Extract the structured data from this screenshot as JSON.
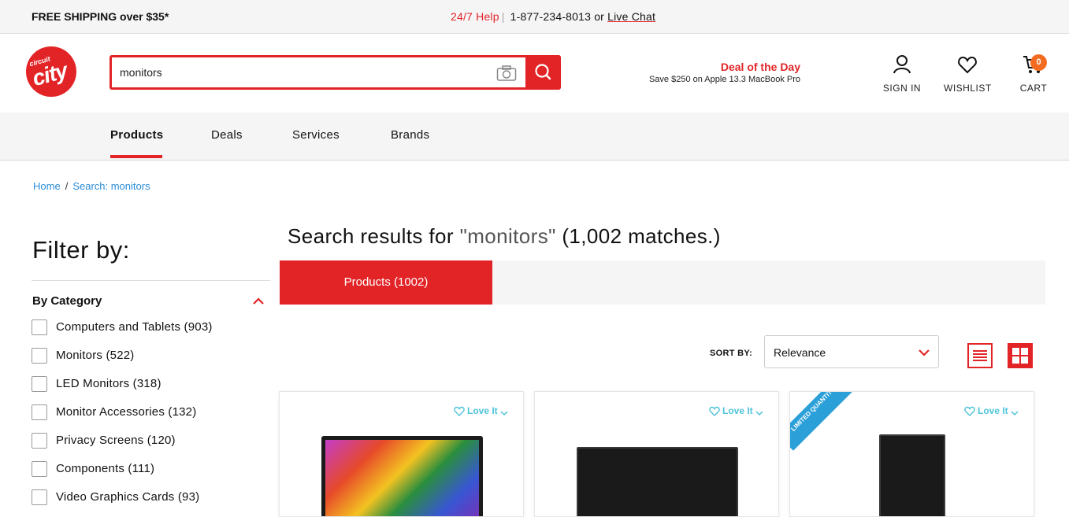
{
  "topbar": {
    "shipping": "FREE SHIPPING over $35*",
    "help_label": "24/7 Help",
    "separator": "|",
    "phone": "1-877-234-8013 or",
    "chat": "Live Chat"
  },
  "header": {
    "logo_small": "circuit",
    "logo_big": "city",
    "search_value": "monitors",
    "deal_title": "Deal of the Day",
    "deal_sub": "Save $250 on Apple 13.3 MacBook Pro",
    "sign_in": "SIGN IN",
    "wishlist": "WISHLIST",
    "cart": "CART",
    "cart_count": "0"
  },
  "nav": {
    "items": [
      "Products",
      "Deals",
      "Services",
      "Brands"
    ]
  },
  "breadcrumb": {
    "home": "Home",
    "sep": "/",
    "current": "Search: monitors"
  },
  "filter": {
    "title": "Filter by:",
    "category_title": "By Category",
    "categories": [
      "Computers and Tablets (903)",
      "Monitors (522)",
      "LED Monitors (318)",
      "Monitor Accessories (132)",
      "Privacy Screens (120)",
      "Components (111)",
      "Video Graphics Cards (93)"
    ]
  },
  "results": {
    "prefix": "Search results for ",
    "query": "\"monitors\"",
    "suffix": " (1,002 matches.)",
    "tab": "Products (1002)",
    "sort_label": "SORT BY:",
    "sort_value": "Relevance"
  },
  "cards": {
    "love_label": "Love It",
    "ribbon": "LIMITED QUANTITY"
  },
  "colors": {
    "brand_red": "#e22427",
    "link_blue": "#2a8cd7",
    "love_teal": "#4ec3d9",
    "badge_orange": "#f36b21"
  }
}
